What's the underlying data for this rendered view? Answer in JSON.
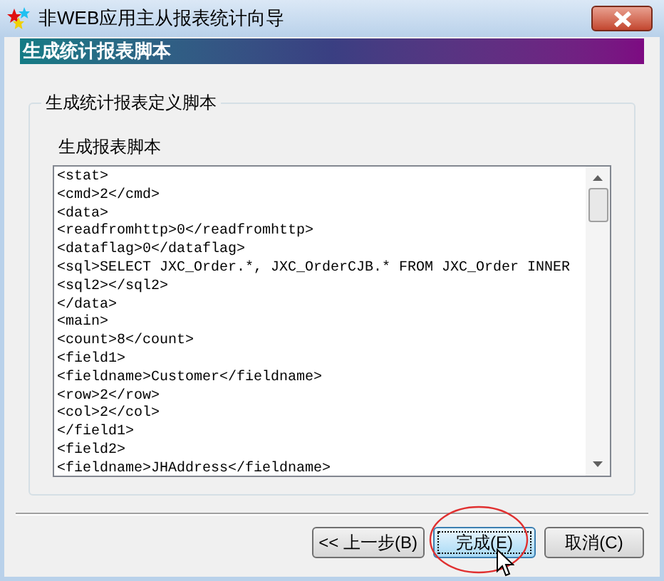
{
  "window": {
    "title": "非WEB应用主从报表统计向导"
  },
  "banner": "生成统计报表脚本",
  "group": {
    "title": "生成统计报表定义脚本",
    "label": "生成报表脚本",
    "lines": [
      "<stat>",
      "<cmd>2</cmd>",
      "<data>",
      "<readfromhttp>0</readfromhttp>",
      "<dataflag>0</dataflag>",
      "<sql>SELECT JXC_Order.*, JXC_OrderCJB.* FROM JXC_Order INNER",
      "<sql2></sql2>",
      "</data>",
      "<main>",
      "<count>8</count>",
      "<field1>",
      "<fieldname>Customer</fieldname>",
      "<row>2</row>",
      "<col>2</col>",
      "</field1>",
      "<field2>",
      "<fieldname>JHAddress</fieldname>"
    ]
  },
  "buttons": [
    {
      "label": "<< 上一步(B)",
      "focused": false
    },
    {
      "label": "完成(E)",
      "focused": true
    },
    {
      "label": "取消(C)",
      "focused": false
    }
  ]
}
